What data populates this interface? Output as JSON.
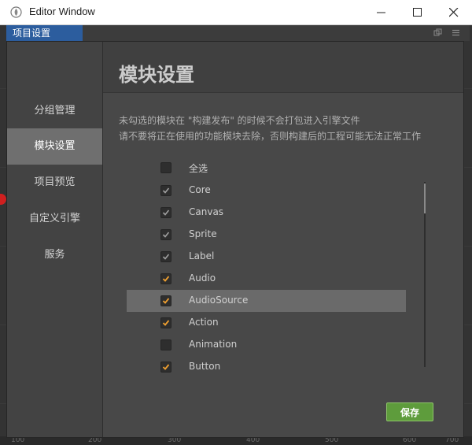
{
  "window": {
    "title": "Editor Window",
    "controls": [
      "minimize-icon",
      "maximize-icon",
      "close-icon"
    ]
  },
  "panel_tab": {
    "label": "项目设置"
  },
  "ruler_labels": [
    "100",
    "200",
    "300",
    "400",
    "500",
    "600",
    "700"
  ],
  "sidebar": {
    "items": [
      {
        "label": "分组管理",
        "active": false
      },
      {
        "label": "模块设置",
        "active": true
      },
      {
        "label": "项目预览",
        "active": false
      },
      {
        "label": "自定义引擎",
        "active": false
      },
      {
        "label": "服务",
        "active": false
      }
    ]
  },
  "main": {
    "title": "模块设置",
    "description_line1": "未勾选的模块在 \"构建发布\" 的时候不会打包进入引擎文件",
    "description_line2": "请不要将正在使用的功能模块去除，否则构建后的工程可能无法正常工作",
    "select_all": {
      "label": "全选",
      "checked": false
    },
    "modules": [
      {
        "label": "Core",
        "checked": true,
        "locked": true
      },
      {
        "label": "Canvas",
        "checked": true,
        "locked": true
      },
      {
        "label": "Sprite",
        "checked": true,
        "locked": true
      },
      {
        "label": "Label",
        "checked": true,
        "locked": true
      },
      {
        "label": "Audio",
        "checked": true,
        "locked": false
      },
      {
        "label": "AudioSource",
        "checked": true,
        "locked": false,
        "highlighted": true
      },
      {
        "label": "Action",
        "checked": true,
        "locked": false
      },
      {
        "label": "Animation",
        "checked": false,
        "locked": false
      },
      {
        "label": "Button",
        "checked": true,
        "locked": false
      }
    ],
    "save_label": "保存"
  },
  "colors": {
    "accent_check": "#f0a030",
    "locked_check": "#a0a0a0",
    "save_button": "#5e9c3c",
    "tab_blue": "#2c5d9e"
  }
}
